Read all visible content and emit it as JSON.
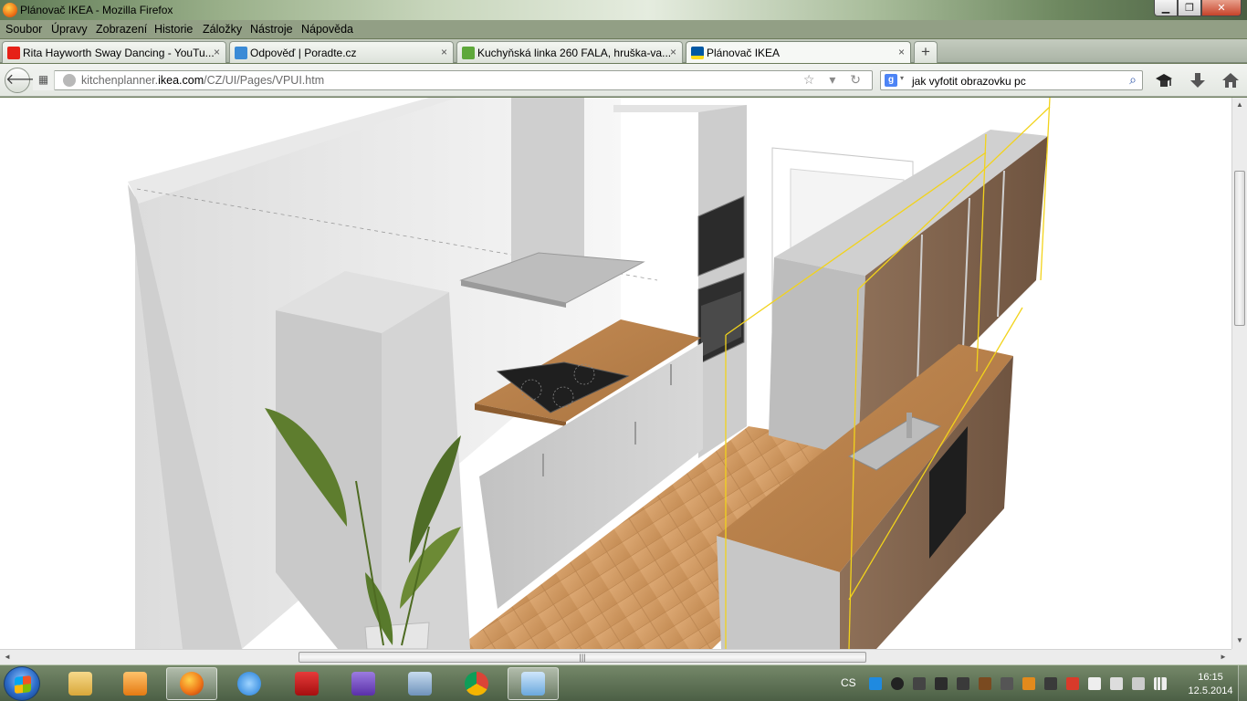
{
  "window": {
    "title": "Plánovač IKEA - Mozilla Firefox",
    "buttons": {
      "minimize": "▁",
      "maximize": "❐",
      "close": "✕"
    }
  },
  "menubar": {
    "items": [
      "Soubor",
      "Úpravy",
      "Zobrazení",
      "Historie",
      "Záložky",
      "Nástroje",
      "Nápověda"
    ]
  },
  "tabs": [
    {
      "label": "Rita Hayworth Sway Dancing - YouTu...",
      "icon": "youtube-icon",
      "color": "#e62117"
    },
    {
      "label": "Odpověď | Poradte.cz",
      "icon": "page-icon",
      "color": "#3b8bd6"
    },
    {
      "label": "Kuchyňská linka 260 FALA, hruška-va...",
      "icon": "leaf-icon",
      "color": "#5ea83a"
    },
    {
      "label": "Plánovač IKEA",
      "icon": "ikea-icon",
      "color": "#0058a3"
    }
  ],
  "tab_close": "×",
  "new_tab": "+",
  "navbar": {
    "back": "🡐",
    "url_prefix": "kitchenplanner.",
    "url_domain": "ikea.com",
    "url_suffix": "/CZ/UI/Pages/VPUI.htm",
    "url_icons": "☆ ▾ ↻",
    "search_engine": "g",
    "search_engine_arrow": "▾",
    "search_query": "jak vyfotit obrazovku pc",
    "search_icon": "⌕",
    "extra_icons": [
      "mortarboard-icon",
      "download-icon",
      "home-icon"
    ]
  },
  "scrollbars": {
    "up": "▲",
    "down": "▼",
    "left": "◄",
    "right": "►",
    "grip": "|||"
  },
  "taskbar": {
    "apps": [
      {
        "name": "explorer",
        "color": "#e9c25a"
      },
      {
        "name": "media-player",
        "color": "#f29a2e"
      },
      {
        "name": "firefox",
        "color": "#e8641b",
        "active": true
      },
      {
        "name": "internet-explorer",
        "color": "#2a8be0"
      },
      {
        "name": "acrobat",
        "color": "#c4141b"
      },
      {
        "name": "visual-studio",
        "color": "#6a3fb5"
      },
      {
        "name": "calculator",
        "color": "#7ea2c6"
      },
      {
        "name": "chrome",
        "color": "#d9453a"
      },
      {
        "name": "paint",
        "color": "#7db7e6",
        "active": true
      }
    ],
    "language": "CS",
    "time": "16:15",
    "date": "12.5.2014"
  },
  "colors": {
    "countertop": "#b8804a",
    "floor": "#d3a06a",
    "cabinet": "#c9c9c9",
    "wall": "#ffffff",
    "highlight": "#f2d31b"
  }
}
